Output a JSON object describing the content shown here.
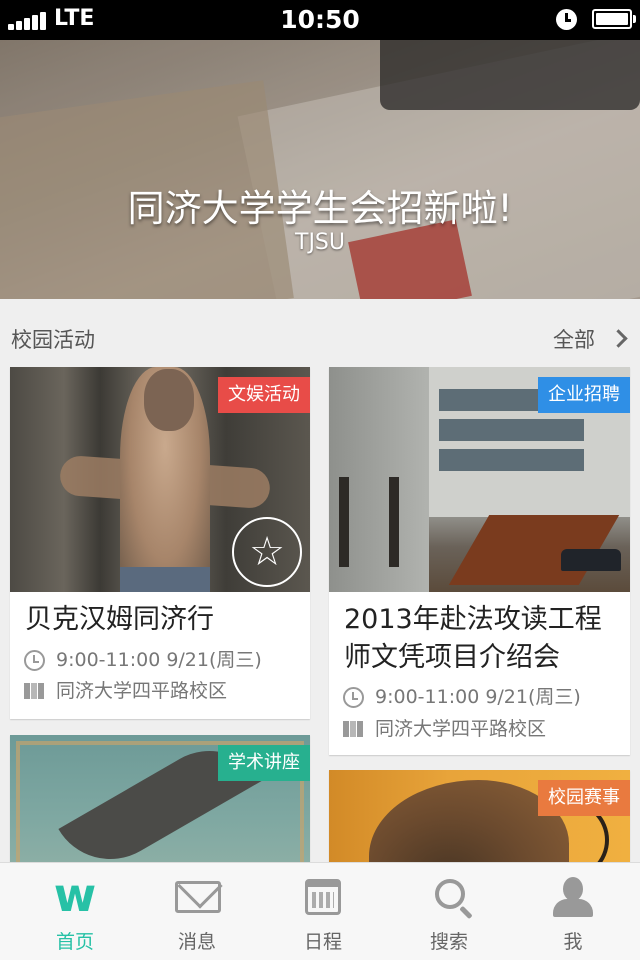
{
  "status_bar": {
    "carrier": "LTE",
    "time": "10:50"
  },
  "banner": {
    "title": "同济大学学生会招新啦!",
    "subtitle": "TJSU",
    "page_count": 4,
    "active_page": 1
  },
  "section": {
    "title": "校园活动",
    "all_label": "全部"
  },
  "cards": [
    {
      "tag": "文娱活动",
      "tag_color": "#e84c48",
      "title": "贝克汉姆同济行",
      "time": "9:00-11:00 9/21(周三)",
      "location": "同济大学四平路校区"
    },
    {
      "tag": "企业招聘",
      "tag_color": "#2f8fe6",
      "title": "2013年赴法攻读工程师文凭项目介绍会",
      "time": "9:00-11:00 9/21(周三)",
      "location": "同济大学四平路校区"
    },
    {
      "tag": "学术讲座",
      "tag_color": "#27b08f"
    },
    {
      "tag": "校园赛事",
      "tag_color": "#e97a3f"
    }
  ],
  "tabbar": {
    "items": [
      {
        "label": "首页",
        "icon": "w-logo-icon",
        "active": true
      },
      {
        "label": "消息",
        "icon": "mail-icon"
      },
      {
        "label": "日程",
        "icon": "calendar-icon"
      },
      {
        "label": "搜索",
        "icon": "search-icon"
      },
      {
        "label": "我",
        "icon": "user-icon"
      }
    ],
    "active_color": "#27c1a6"
  }
}
